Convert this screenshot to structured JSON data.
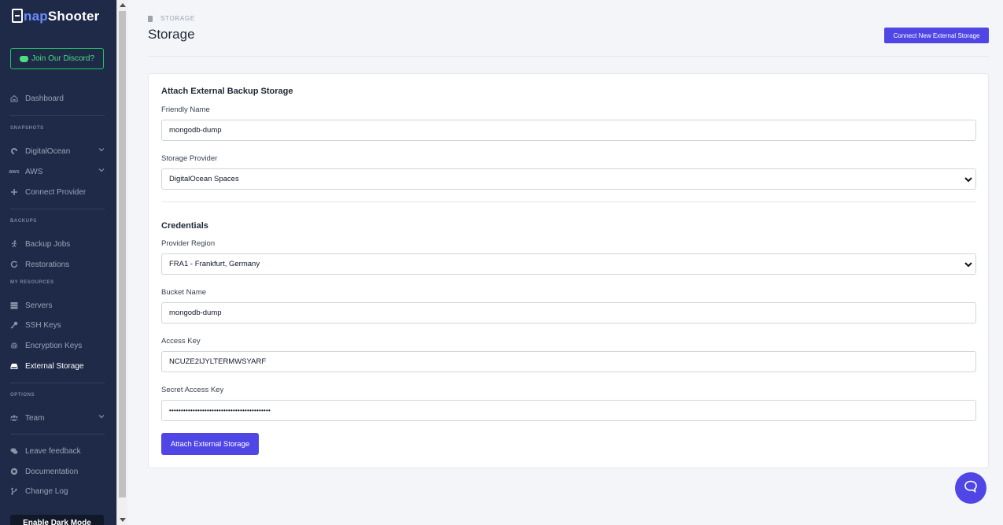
{
  "sidebar": {
    "logo": {
      "prefix": "S",
      "accent": "nap",
      "rest": "Shooter"
    },
    "discord_label": "Join Our Discord?",
    "dashboard": "Dashboard",
    "snapshots_label": "SNAPSHOTS",
    "snapshots": [
      {
        "label": "DigitalOcean",
        "icon": "digitalocean-icon"
      },
      {
        "label": "AWS",
        "icon": "aws-icon"
      },
      {
        "label": "Connect Provider",
        "icon": "plus-icon"
      }
    ],
    "backups_label": "BACKUPS",
    "backups": [
      {
        "label": "Backup Jobs",
        "icon": "running-icon"
      },
      {
        "label": "Restorations",
        "icon": "refresh-icon"
      }
    ],
    "resources_label": "MY RESOURCES",
    "resources": [
      {
        "label": "Servers",
        "icon": "server-icon"
      },
      {
        "label": "SSH Keys",
        "icon": "key-icon"
      },
      {
        "label": "Encryption Keys",
        "icon": "fingerprint-icon"
      },
      {
        "label": "External Storage",
        "icon": "hdd-icon"
      }
    ],
    "options_label": "OPTIONS",
    "team": "Team",
    "footer_links": [
      {
        "label": "Leave feedback",
        "icon": "comments-icon"
      },
      {
        "label": "Documentation",
        "icon": "lifebuoy-icon"
      },
      {
        "label": "Change Log",
        "icon": "git-branch-icon"
      }
    ],
    "dark_mode_label": "Enable Dark Mode"
  },
  "header": {
    "breadcrumb": "STORAGE",
    "title": "Storage",
    "connect_button": "Connect New External Storage"
  },
  "form": {
    "title": "Attach External Backup Storage",
    "friendly_name_label": "Friendly Name",
    "friendly_name_value": "mongodb-dump",
    "storage_provider_label": "Storage Provider",
    "storage_provider_value": "DigitalOcean Spaces",
    "credentials_title": "Credentials",
    "region_label": "Provider Region",
    "region_value": "FRA1 - Frankfurt, Germany",
    "bucket_label": "Bucket Name",
    "bucket_value": "mongodb-dump",
    "access_key_label": "Access Key",
    "access_key_value": "NCUZE2IJYLTERMWSYARF",
    "secret_key_label": "Secret Access Key",
    "secret_key_value": "•••••••••••••••••••••••••••••••••••••••••••",
    "submit_label": "Attach External Storage"
  },
  "colors": {
    "sidebar_bg": "#1e2a47",
    "primary": "#4f46e5",
    "discord": "#22c55e"
  }
}
